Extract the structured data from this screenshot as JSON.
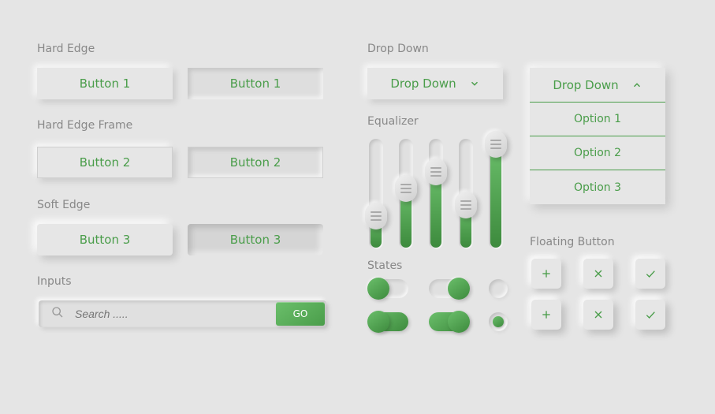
{
  "sections": {
    "hard_edge": "Hard Edge",
    "hard_edge_frame": "Hard Edge Frame",
    "soft_edge": "Soft Edge",
    "inputs": "Inputs",
    "dropdown": "Drop Down",
    "equalizer": "Equalizer",
    "states": "States",
    "floating_button": "Floating Button"
  },
  "buttons": {
    "b1a": "Button 1",
    "b1b": "Button 1",
    "b2a": "Button 2",
    "b2b": "Button 2",
    "b3a": "Button 3",
    "b3b": "Button 3"
  },
  "search": {
    "placeholder": "Search .....",
    "go": "GO"
  },
  "dropdown": {
    "closed_label": "Drop Down",
    "open_label": "Drop Down",
    "options": [
      "Option 1",
      "Option 2",
      "Option 3"
    ]
  },
  "equalizer": {
    "values_pct": [
      30,
      55,
      70,
      40,
      95
    ]
  },
  "states": {
    "row1": {
      "toggle_left": "off",
      "toggle_right": "on",
      "radio": "off"
    },
    "row2": {
      "toggle_left": "off",
      "toggle_right": "on",
      "radio": "on"
    }
  },
  "fab_icons": {
    "row1": [
      "plus",
      "close",
      "check"
    ],
    "row2": [
      "plus",
      "close",
      "check"
    ]
  },
  "colors": {
    "accent": "#4a9d4a",
    "background": "#e5e5e5"
  }
}
